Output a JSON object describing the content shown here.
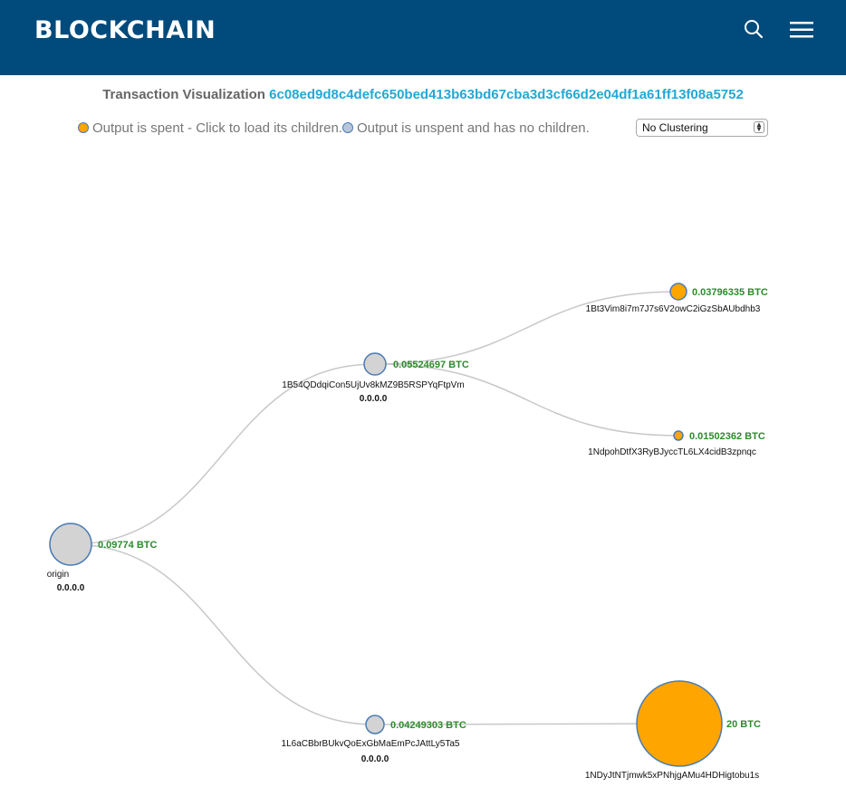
{
  "header": {
    "logo": "BLOCKCHAIN"
  },
  "title": {
    "label": "Transaction Visualization",
    "hash": "6c08ed9d8c4defc650bed413b63bd67cba3d3cf66d2e04df1a61ff13f08a5752"
  },
  "legend": {
    "spent_text": "Output is spent - Click to load its children.",
    "unspent_text": "Output is unspent and has no children."
  },
  "clustering": {
    "selected": "No Clustering"
  },
  "colors": {
    "header_bg": "#004a7c",
    "link": "#23a9d5",
    "spent": "#ffa500",
    "unspent": "#d3d3d3",
    "amount": "#2d8a2d"
  },
  "graph": {
    "nodes": [
      {
        "id": "origin",
        "address": "origin",
        "amount": "0.09774 BTC",
        "sub": "0.0.0.0",
        "status": "unspent"
      },
      {
        "id": "n1",
        "address": "1B54QDdqiCon5UjUv8kMZ9B5RSPYqFtpVm",
        "amount": "0.05524697 BTC",
        "sub": "0.0.0.0",
        "status": "unspent"
      },
      {
        "id": "n2",
        "address": "1L6aCBbrBUkvQoExGbMaEmPcJAttLy5Ta5",
        "amount": "0.04249303 BTC",
        "sub": "0.0.0.0",
        "status": "unspent"
      },
      {
        "id": "n3",
        "address": "1Bt3Vim8i7m7J7s6V2owC2iGzSbAUbdhb3",
        "amount": "0.03796335 BTC",
        "status": "spent"
      },
      {
        "id": "n4",
        "address": "1NdpohDtfX3RyBJyccTL6LX4cidB3zpnqc",
        "amount": "0.01502362 BTC",
        "status": "spent"
      },
      {
        "id": "n5",
        "address": "1NDyJtNTjmwk5xPNhjgAMu4HDHigtobu1s",
        "amount": "20 BTC",
        "status": "spent"
      }
    ]
  }
}
